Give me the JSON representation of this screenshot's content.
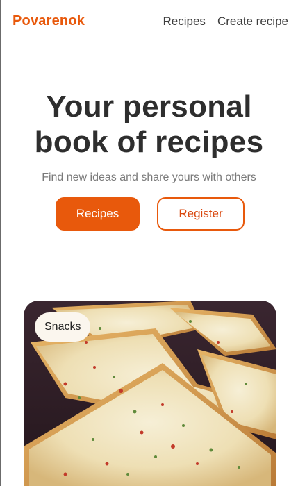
{
  "header": {
    "logo": "Povarenok",
    "nav": [
      {
        "label": "Recipes"
      },
      {
        "label": "Create recipe"
      }
    ]
  },
  "hero": {
    "title_line1": "Your personal",
    "title_line2": "book of recipes",
    "subtitle": "Find new ideas and share yours with others",
    "primary_button": "Recipes",
    "secondary_button": "Register"
  },
  "card": {
    "category_badge": "Snacks",
    "image": "garlic-cheese-toast-photo"
  },
  "colors": {
    "accent": "#e8590c",
    "text": "#2e2e2e",
    "muted": "#7a7a7a"
  }
}
